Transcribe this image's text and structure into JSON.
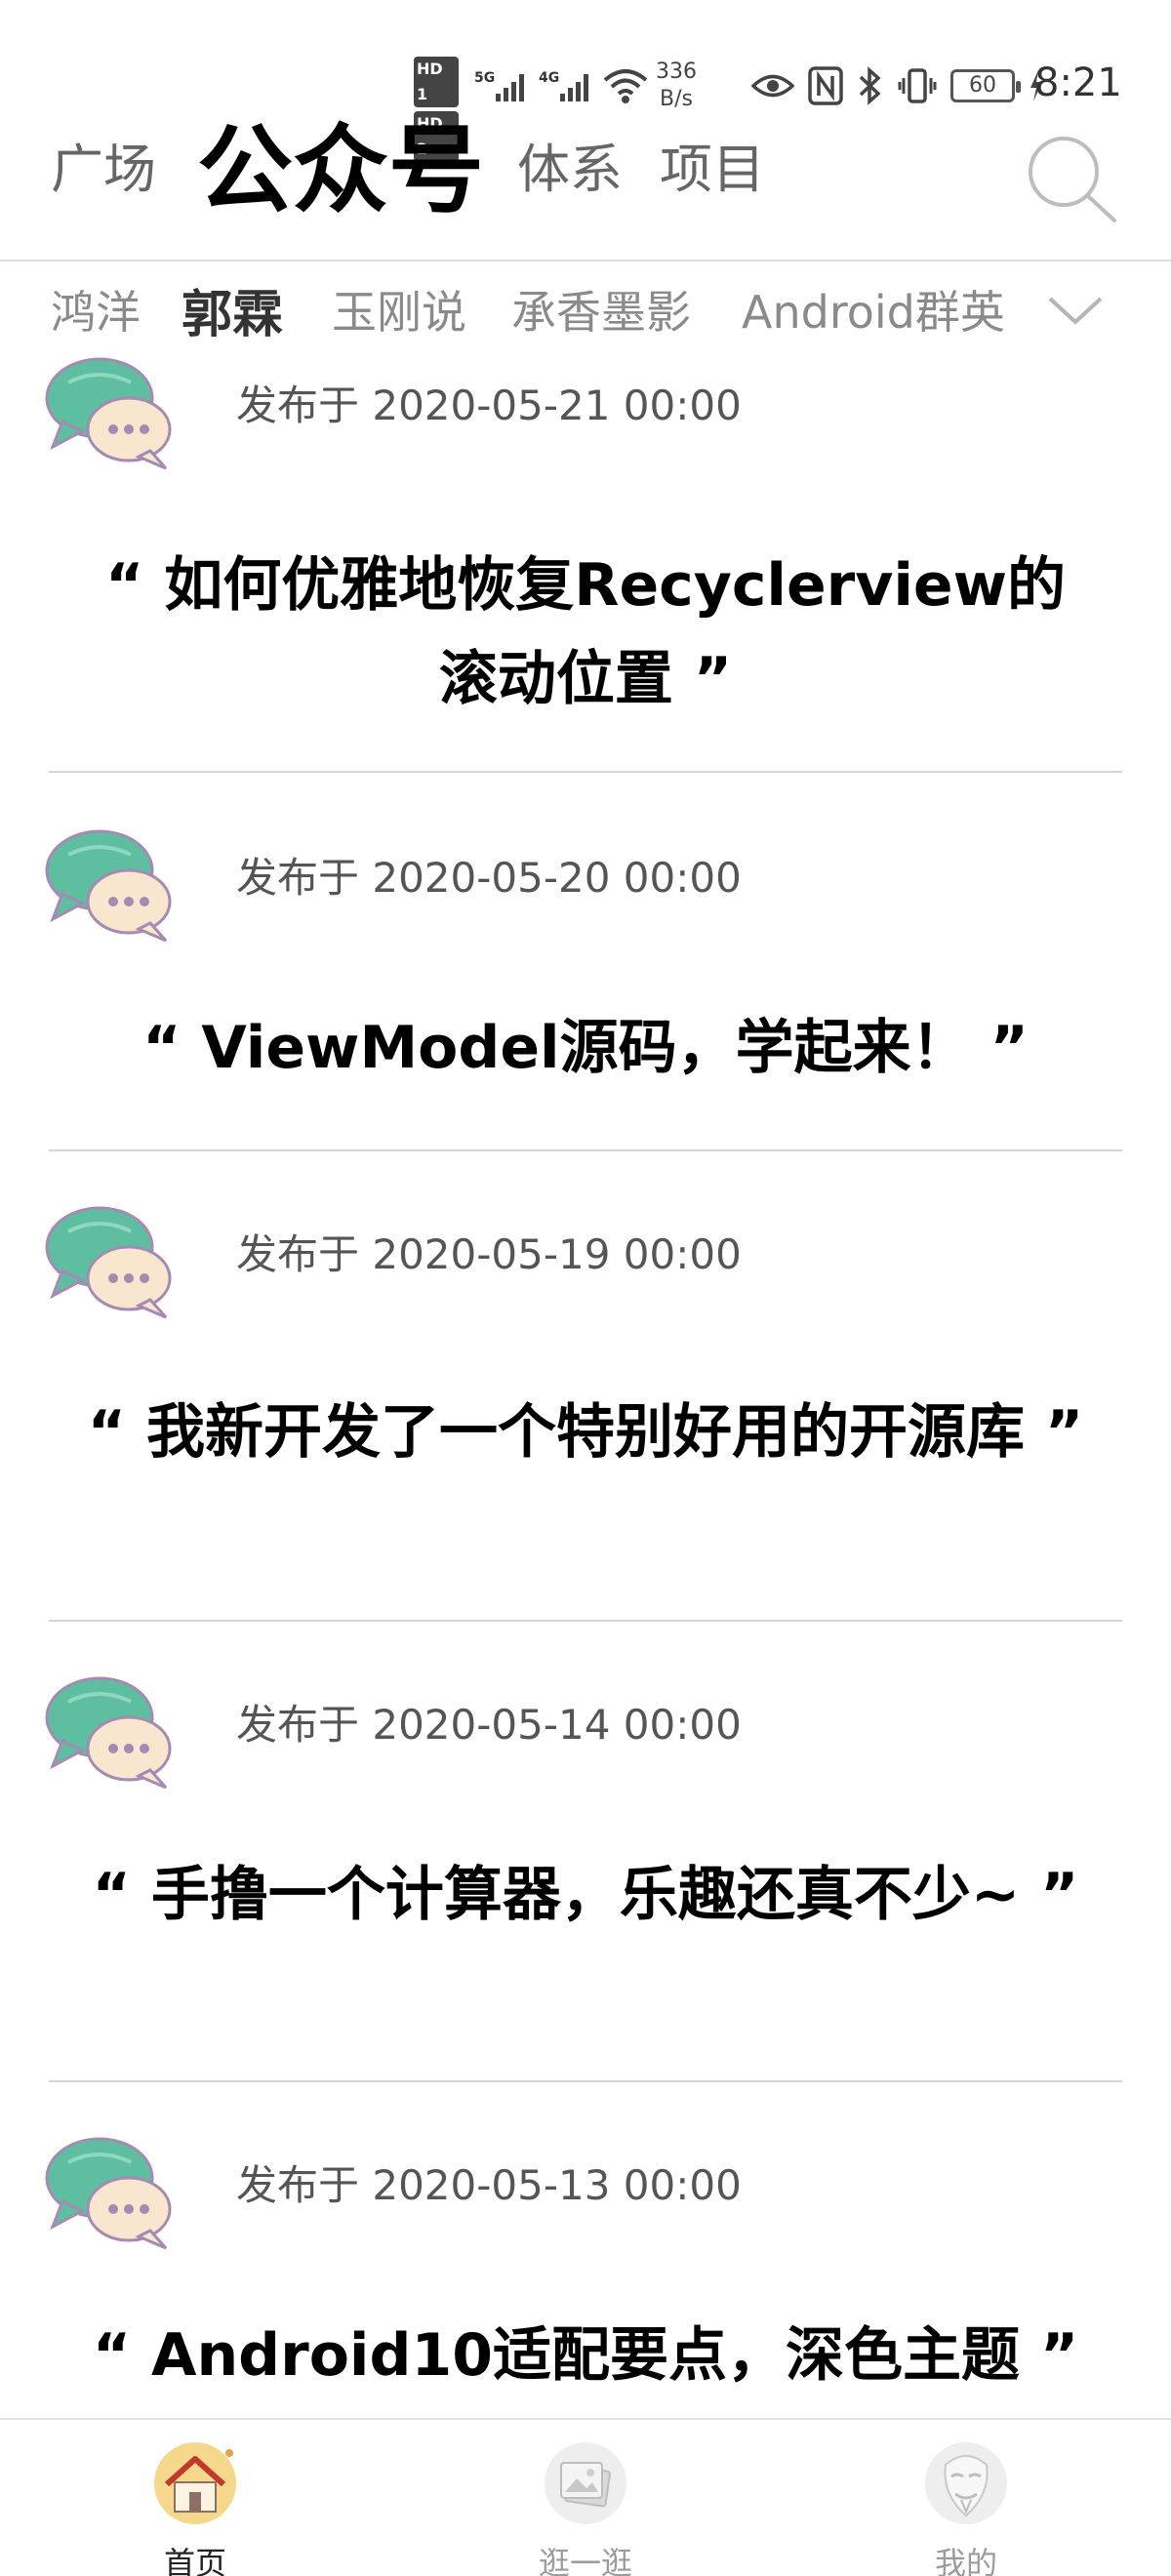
{
  "status_bar": {
    "hd1": "HD 1",
    "hd2": "HD 2",
    "net1": "5G",
    "net2": "4G",
    "rate_value": "336",
    "rate_unit": "B/s",
    "battery": "60",
    "time": "8:21"
  },
  "top_tabs": [
    {
      "label": "广场"
    },
    {
      "label": "公众号"
    },
    {
      "label": "体系"
    },
    {
      "label": "项目"
    }
  ],
  "sub_tabs": [
    {
      "label": "鸿洋"
    },
    {
      "label": "郭霖"
    },
    {
      "label": "玉刚说"
    },
    {
      "label": "承香墨影"
    },
    {
      "label": "Android群英"
    }
  ],
  "articles": [
    {
      "date": "发布于 2020-05-21 00:00",
      "title": "“ 如何优雅地恢复Recyclerview的滚动位置 ”"
    },
    {
      "date": "发布于 2020-05-20 00:00",
      "title": "“ ViewModel源码，学起来！ ”"
    },
    {
      "date": "发布于 2020-05-19 00:00",
      "title": "“ 我新开发了一个特别好用的开源库 ”"
    },
    {
      "date": "发布于 2020-05-14 00:00",
      "title": "“ 手撸一个计算器，乐趣还真不少~ ”"
    },
    {
      "date": "发布于 2020-05-13 00:00",
      "title": "“ Android10适配要点，深色主题 ”"
    }
  ],
  "bottom_nav": [
    {
      "label": "首页"
    },
    {
      "label": "逛一逛"
    },
    {
      "label": "我的"
    }
  ],
  "colors": {
    "chat_green": "#5dbf9f",
    "chat_cream": "#f8e6cf",
    "chat_outline": "#a58ab3"
  }
}
